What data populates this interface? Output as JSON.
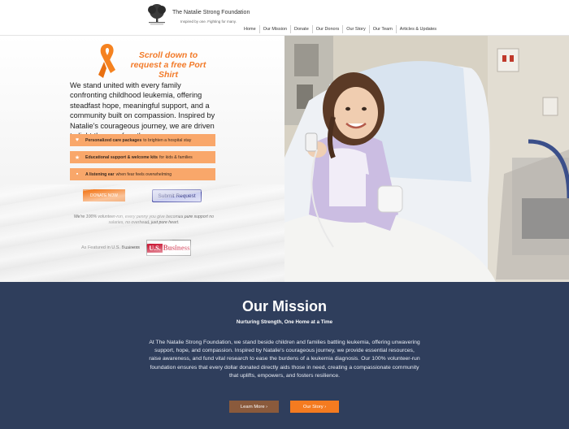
{
  "header": {
    "brand": "The Natalie Strong Foundation",
    "tagline": "Inspired by one. Fighting for many.",
    "nav": [
      "Home",
      "Our Mission",
      "Donate",
      "Our Donors",
      "Our Story",
      "Our Team",
      "Articles & Updates"
    ]
  },
  "hero": {
    "scroll_cta": "Scroll down to request a free Port Shirt",
    "lead": "We stand united with every family confronting childhood leukemia, offering steadfast hope, meaningful support, and a community built on compassion. Inspired by Natalie's courageous journey, we are driven to light the way for others.",
    "benefits": [
      {
        "icon": "heart-icon",
        "strong": "Personalized care packages",
        "rest": "to brighten a hospital stay"
      },
      {
        "icon": "star-icon",
        "strong": "Educational support & welcome kits",
        "rest": "for kids & families"
      },
      {
        "icon": "chat-icon",
        "strong": "A listening ear",
        "rest": "when fear feels overwhelming"
      }
    ],
    "donate_label": "DONATE NOW",
    "request_label": "Submit Request",
    "volunteer_note": "We're 100% volunteer-run, every penny you give becomes pure support no salaries, no overhead, just pure heart.",
    "featured_label": "As Featured in U.S. Business",
    "usb_us": "U.S.",
    "usb_business": "Business"
  },
  "mission": {
    "title": "Our Mission",
    "subtitle": "Nurturing Strength, One Home at a Time",
    "body": "At The Natalie Strong Foundation, we stand beside children and families battling leukemia, offering unwavering support, hope, and compassion. Inspired by Natalie's courageous journey, we provide essential resources, raise awareness, and fund vital research to ease the burdens of a leukemia diagnosis. Our 100% volunteer-run foundation ensures that every dollar donated directly aids those in need, creating a compassionate community that uplifts, empowers, and fosters resilience.",
    "learn_more": "Learn More ›",
    "our_story": "Our Story ›"
  },
  "colors": {
    "accent_orange": "#f47b20",
    "benefit_bg": "#f9a76a",
    "mission_bg": "#2f3e5c",
    "learn_btn": "#8a5a3c",
    "request_btn": "#c9cdf0"
  }
}
